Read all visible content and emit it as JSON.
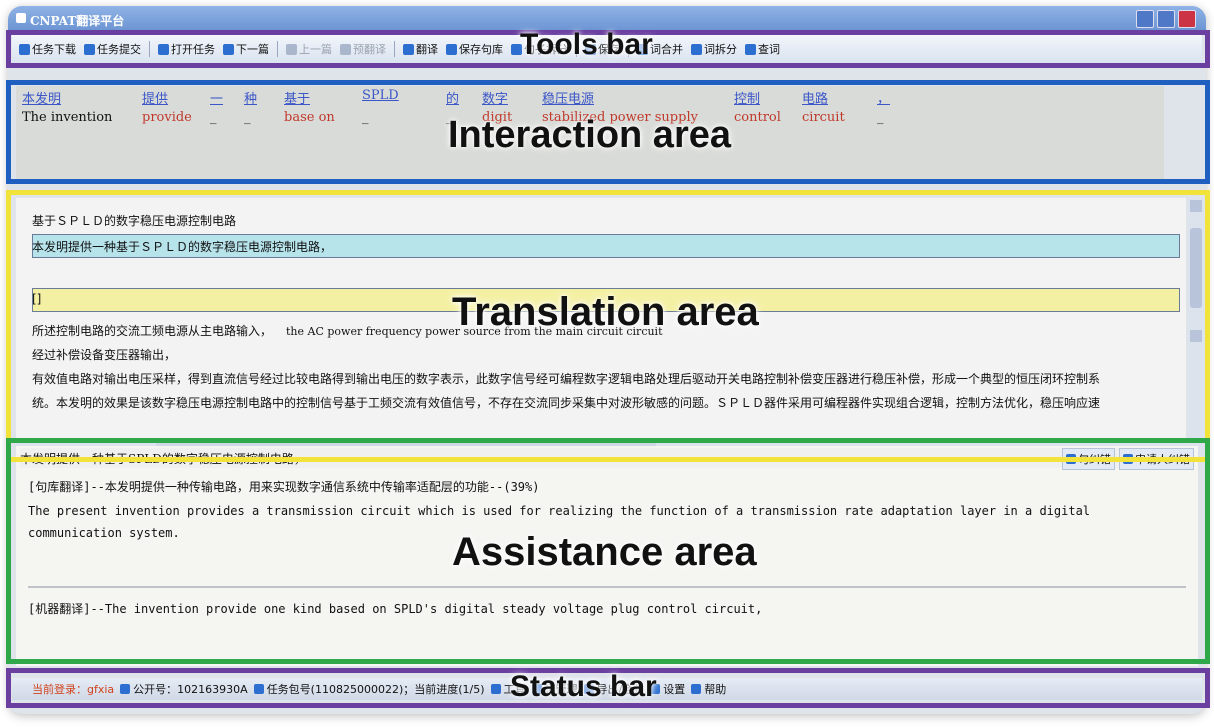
{
  "window": {
    "title": "CNPAT翻译平台"
  },
  "toolbar": {
    "items": [
      {
        "label": "任务下载",
        "disabled": false
      },
      {
        "label": "任务提交",
        "disabled": false
      },
      {
        "label": "打开任务",
        "disabled": false
      },
      {
        "label": "下一篇",
        "disabled": false
      },
      {
        "label": "上一篇",
        "disabled": true
      },
      {
        "label": "预翻译",
        "disabled": true
      },
      {
        "label": "翻译",
        "disabled": false
      },
      {
        "label": "保存句库",
        "disabled": false
      },
      {
        "label": "句子拆分",
        "disabled": false
      },
      {
        "label": "保存",
        "disabled": false
      },
      {
        "label": "词合并",
        "disabled": false
      },
      {
        "label": "词拆分",
        "disabled": false
      },
      {
        "label": "查词",
        "disabled": false
      }
    ]
  },
  "interaction": {
    "source_words": [
      "本发明",
      "提供",
      "一",
      "种",
      "基于",
      "SPLD",
      "的",
      "数字",
      "稳压电源",
      "控制",
      "电路",
      "，"
    ],
    "target_words": [
      "The invention",
      "provide",
      "_",
      "_",
      "base on",
      "_",
      "_",
      "digit",
      "stabilized power supply",
      "control",
      "circuit",
      "_"
    ]
  },
  "translation": {
    "lines": [
      "基于ＳＰＬＤ的数字稳压电源控制电路",
      "本发明提供一种基于ＳＰＬＤ的数字稳压电源控制电路，",
      "",
      "[]",
      "所述控制电路的交流工频电源从主电路输入，",
      "经过补偿设备变压器输出，",
      "有效值电路对输出电压采样，得到直流信号经过比较电路得到输出电压的数字表示，此数字信号经可编程数字逻辑电路处理后驱动开关电路控制补偿变压器进行稳压补偿，形成一个典型的恒压闭环控制系",
      "统。本发明的效果是该数字稳压电源控制电路中的控制信号基于工频交流有效值信号，不存在交流同步采集中对波形敏感的问题。ＳＰＬＤ器件采用可编程器件实现组合逻辑，控制方法优化，稳压响应速"
    ],
    "inline_english": "the AC power frequency power source from the main circuit circuit"
  },
  "assistance": {
    "source_sentence": "本发明提供一种基于SPLD的数字稳压电源控制电路，",
    "buttons": [
      "句纠错",
      "申请人纠错"
    ],
    "corpus_label": "[句库翻译]--本发明提供一种传输电路，用来实现数字通信系统中传输率适配层的功能--(39%)",
    "corpus_translation": "The present invention provides a transmission circuit which is used for realizing the function of a transmission rate adaptation layer in a digital communication system.",
    "machine_translation": "[机器翻译]--The invention provide one kind based on SPLD's digital steady voltage plug control circuit,"
  },
  "statusbar": {
    "user": "当前登录：gfxia",
    "items": [
      "公开号：102163930A",
      "任务包号(110825000022)；当前进度(1/5)",
      "工具",
      "词管理",
      "导出/合并",
      "设置",
      "帮助"
    ]
  },
  "annotations": {
    "tools_bar": "Tools bar",
    "interaction_area": "Interaction area",
    "translation_area": "Translation area",
    "assistance_area": "Assistance area",
    "status_bar": "Status bar"
  },
  "colors": {
    "tools_bar": "#6b3fa0",
    "interaction_area": "#1f5fbf",
    "translation_area": "#f2e33a",
    "assistance_area": "#2fa84a",
    "status_bar": "#6b3fa0"
  }
}
